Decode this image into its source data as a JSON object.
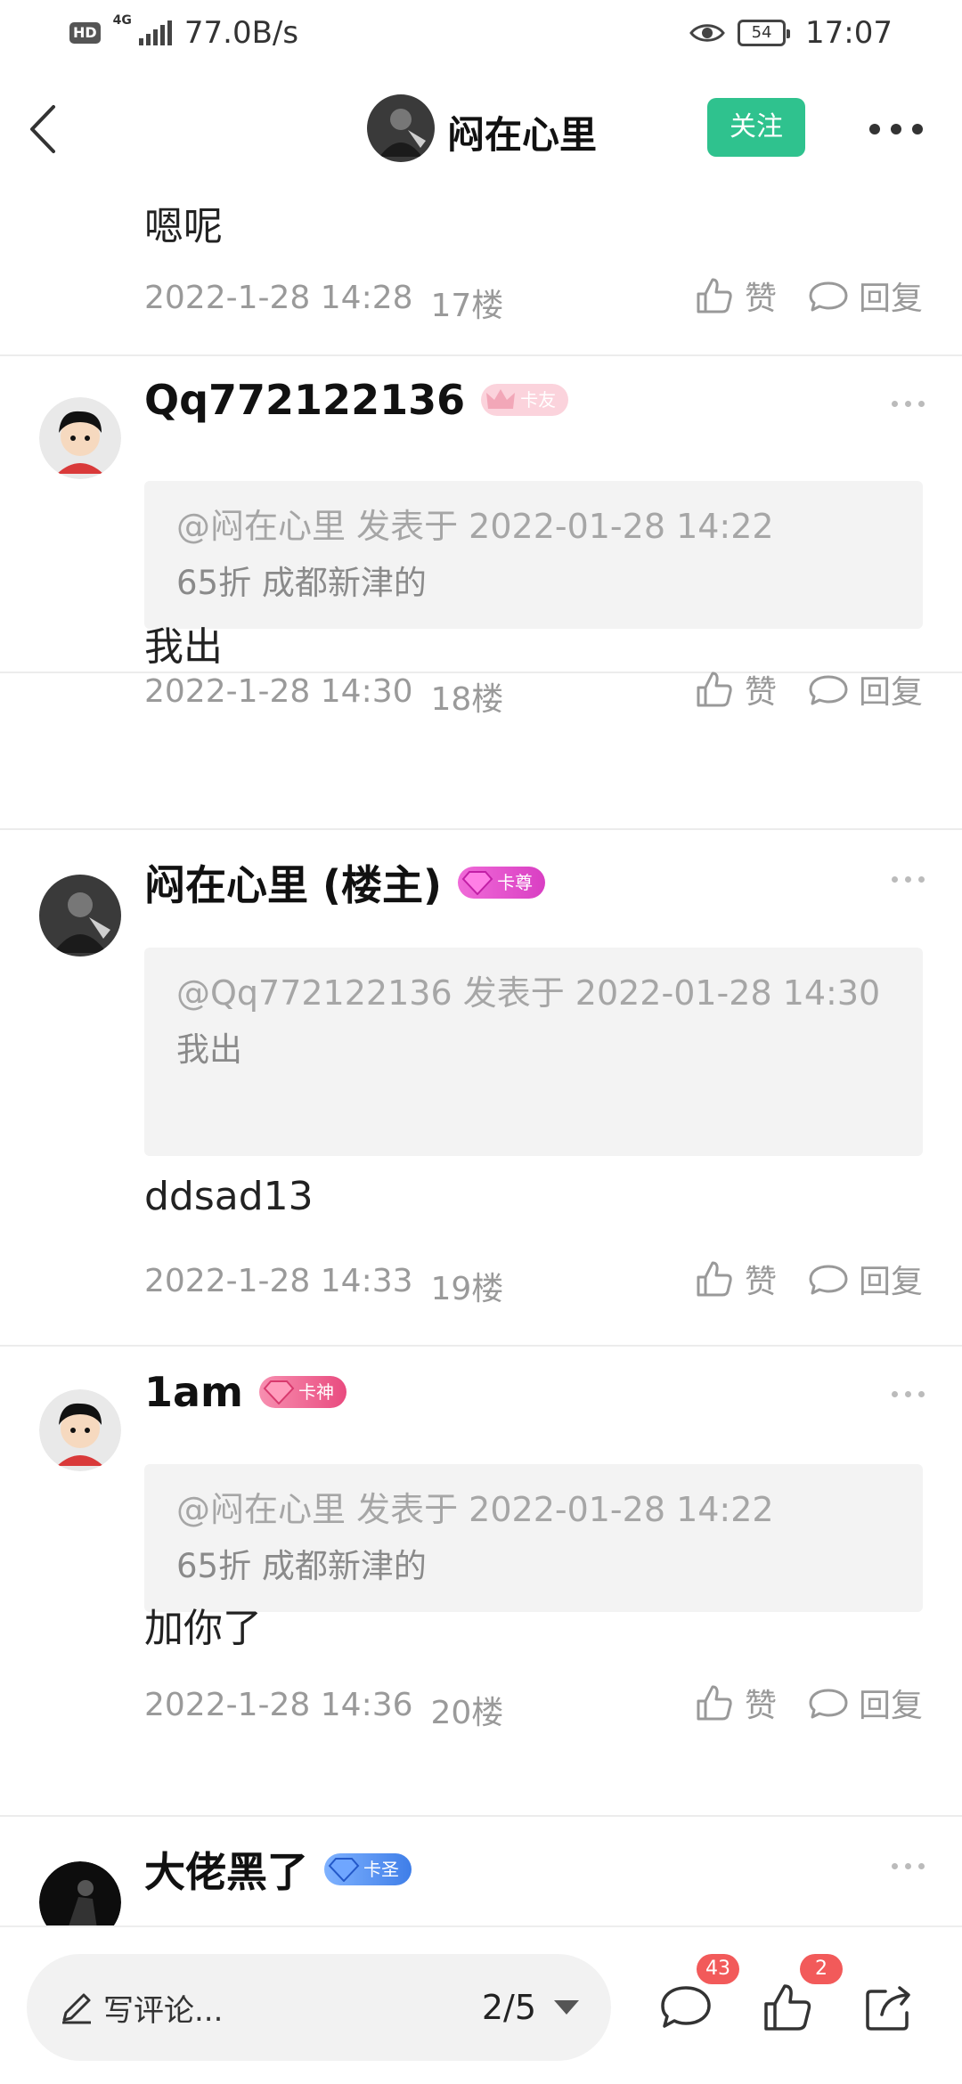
{
  "status_bar": {
    "hd": "HD",
    "network": "4G",
    "speed": "77.0B/s",
    "battery": "54",
    "time": "17:07"
  },
  "header": {
    "title": "闷在心里",
    "follow_label": "关注"
  },
  "partial_post": {
    "content": "嗯呢",
    "date": "2022-1-28 14:28",
    "floor": "17楼",
    "like_label": "赞",
    "reply_label": "回复"
  },
  "comments": [
    {
      "username": "Qq772122136",
      "badge": "卡友",
      "quote_meta": "@闷在心里 发表于 2022-01-28 14:22",
      "quote_text": "65折 成都新津的",
      "content": "我出",
      "date": "2022-1-28 14:30",
      "floor": "18楼",
      "like_label": "赞",
      "reply_label": "回复"
    },
    {
      "username": "闷在心里 (楼主)",
      "badge": "卡尊",
      "quote_meta": "@Qq772122136 发表于 2022-01-28 14:30",
      "quote_text": "我出",
      "content": "ddsad13",
      "date": "2022-1-28 14:33",
      "floor": "19楼",
      "like_label": "赞",
      "reply_label": "回复"
    },
    {
      "username": "1am",
      "badge": "卡神",
      "quote_meta": "@闷在心里 发表于 2022-01-28 14:22",
      "quote_text": "65折 成都新津的",
      "content": "加你了",
      "date": "2022-1-28 14:36",
      "floor": "20楼",
      "like_label": "赞",
      "reply_label": "回复"
    },
    {
      "username": "大佬黑了",
      "badge": "卡圣"
    }
  ],
  "bottom_bar": {
    "placeholder": "写评论...",
    "page": "2/5",
    "comment_count": "43",
    "like_count": "2"
  },
  "colors": {
    "accent": "#2fc28e",
    "badge_red": "#f25a5a",
    "badge_kayou": "#f7b8c4",
    "badge_kazun": "#e64bd1",
    "badge_kashen": "#f05a8c",
    "badge_kasheng": "#4a8cf0"
  }
}
